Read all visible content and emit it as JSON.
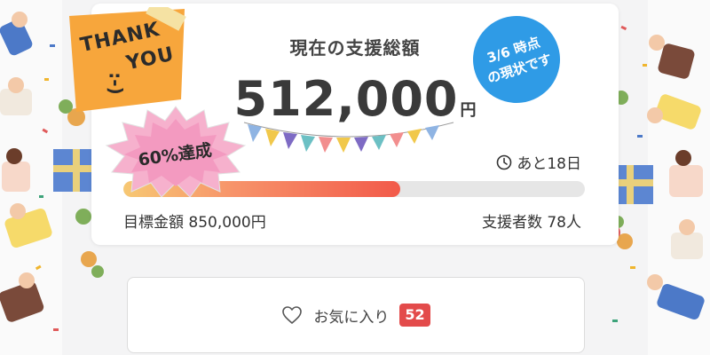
{
  "card": {
    "title": "現在の支援総額",
    "amount": "512,000",
    "unit": "円",
    "remaining": "あと18日",
    "progress_percent": 60,
    "goal": "目標金額 850,000円",
    "supporters": "支援者数 78人"
  },
  "badges": {
    "achievement": "60%達成",
    "status_line1": "3/6 時点",
    "status_line2": "の現状です"
  },
  "note": {
    "line1": "THANK",
    "line2": "YOU",
    "smile": ":-)"
  },
  "favorite": {
    "label": "お気に入り",
    "count": "52"
  },
  "colors": {
    "accent_red": "#e34b4b",
    "badge_blue": "#2f9be6",
    "note_orange": "#f7a63c",
    "burst_pink": "#f6b1cd",
    "progress_start": "#f7c873",
    "progress_end": "#f25a4a"
  }
}
